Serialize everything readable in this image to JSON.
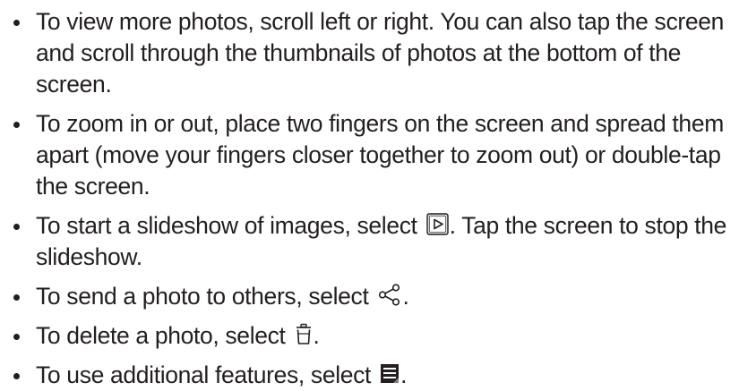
{
  "instructions": {
    "items": [
      {
        "text": "To view more photos, scroll left or right. You can also tap the screen and scroll through the thumbnails of photos at the bottom of the screen."
      },
      {
        "text": "To zoom in or out, place two fingers on the screen and spread them apart (move your fingers closer together to zoom out) or double-tap the screen."
      },
      {
        "text_before": "To start a slideshow of images, select ",
        "icon": "slideshow-icon",
        "text_after": ". Tap the screen to stop the slideshow."
      },
      {
        "text_before": "To send a photo to others, select ",
        "icon": "share-icon",
        "text_after": "."
      },
      {
        "text_before": "To delete a photo, select ",
        "icon": "trash-icon",
        "text_after": "."
      },
      {
        "text_before": "To use additional features, select ",
        "icon": "menu-icon",
        "text_after": "."
      }
    ]
  },
  "colors": {
    "text": "#231f20",
    "background": "#ffffff"
  }
}
